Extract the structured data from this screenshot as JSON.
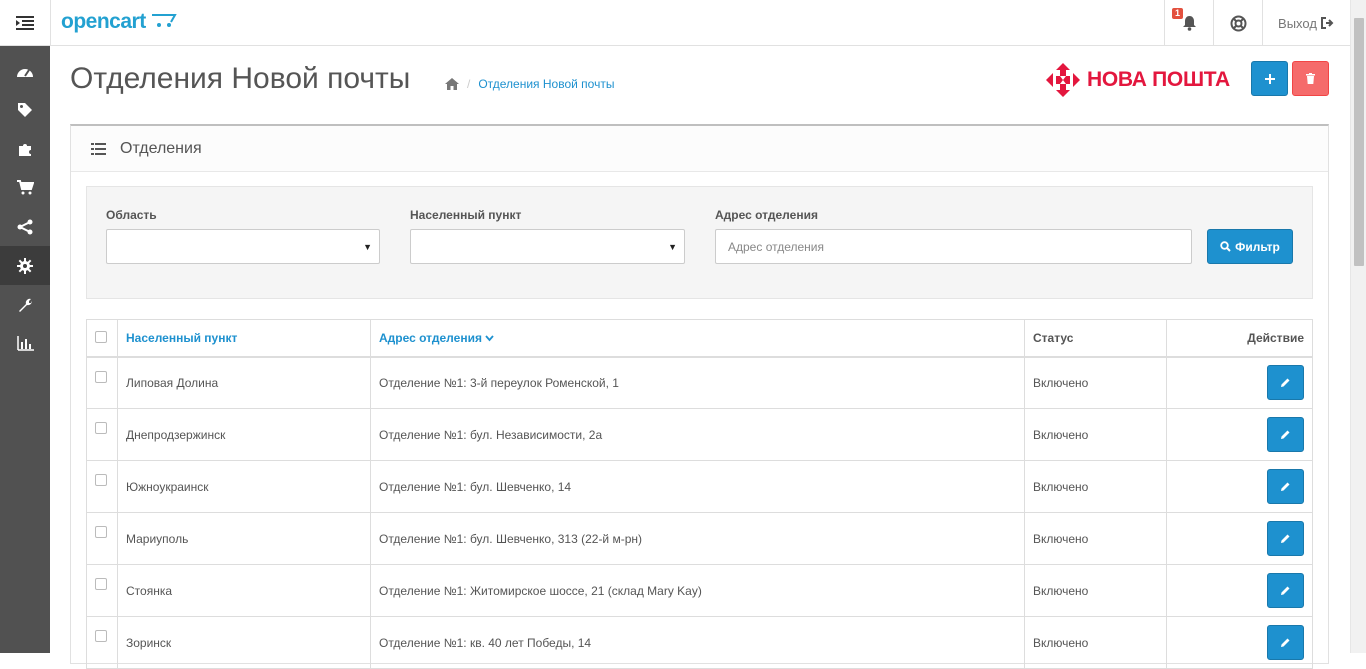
{
  "header": {
    "logo_text": "opencart",
    "notification_count": "1",
    "logout_label": "Выход"
  },
  "sidebar": {
    "items": [
      {
        "icon": "dashboard-icon"
      },
      {
        "icon": "tags-icon"
      },
      {
        "icon": "puzzle-icon"
      },
      {
        "icon": "shopping-cart-icon"
      },
      {
        "icon": "share-icon"
      },
      {
        "icon": "cog-icon",
        "active": true
      },
      {
        "icon": "wrench-icon"
      },
      {
        "icon": "bar-chart-icon"
      }
    ]
  },
  "page": {
    "title": "Отделения Новой почты",
    "breadcrumb_current": "Отделения Новой почты",
    "brand_logo_text": "НОВА ПОШТА",
    "brand_color": "#e3173e"
  },
  "panel": {
    "title": "Отделения"
  },
  "filter": {
    "region_label": "Область",
    "city_label": "Населенный пункт",
    "address_label": "Адрес отделения",
    "address_placeholder": "Адрес отделения",
    "filter_button": "Фильтр"
  },
  "table": {
    "columns": {
      "city": "Населенный пункт",
      "address": "Адрес отделения",
      "status": "Статус",
      "action": "Действие"
    },
    "rows": [
      {
        "city": "Липовая Долина",
        "address": "Отделение №1: 3-й переулок Роменской, 1",
        "status": "Включено"
      },
      {
        "city": "Днепродзержинск",
        "address": "Отделение №1: бул. Независимости, 2а",
        "status": "Включено"
      },
      {
        "city": "Южноукраинск",
        "address": "Отделение №1: бул. Шевченко, 14",
        "status": "Включено"
      },
      {
        "city": "Мариуполь",
        "address": "Отделение №1: бул. Шевченко, 313 (22-й м-рн)",
        "status": "Включено"
      },
      {
        "city": "Стоянка",
        "address": "Отделение №1: Житомирское шоссе, 21 (склад Mary Kay)",
        "status": "Включено"
      },
      {
        "city": "Зоринск",
        "address": "Отделение №1: кв. 40 лет Победы, 14",
        "status": "Включено"
      }
    ]
  },
  "colors": {
    "primary": "#1e91cf",
    "danger": "#f56b6b",
    "sidebar_bg": "#515151"
  }
}
